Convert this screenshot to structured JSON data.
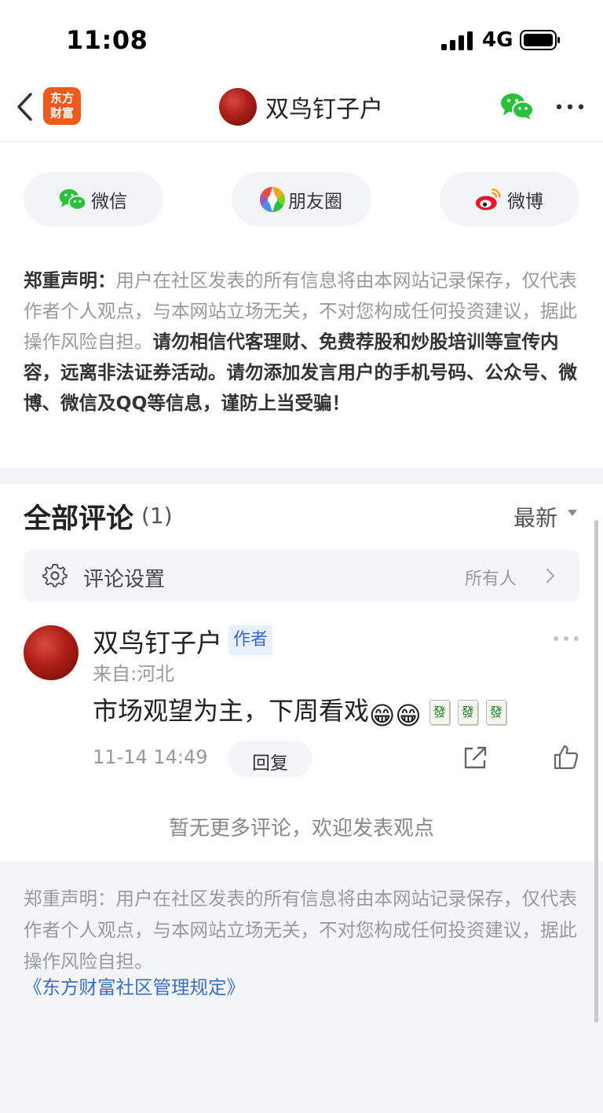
{
  "status_bar": {
    "time": "11:08",
    "network": "4G"
  },
  "nav": {
    "app_logo_line1": "东方",
    "app_logo_line2": "财富",
    "title": "双鸟钉子户"
  },
  "share": {
    "wechat": "微信",
    "moments": "朋友圈",
    "weibo": "微博"
  },
  "disclaimer_top": {
    "lead": "郑重声明：",
    "normal": "用户在社区发表的所有信息将由本网站记录保存，仅代表作者个人观点，与本网站立场无关，不对您构成任何投资建议，据此操作风险自担。",
    "bold": "请勿相信代客理财、免费荐股和炒股培训等宣传内容，远离非法证券活动。请勿添加发言用户的手机号码、公众号、微博、微信及QQ等信息，谨防上当受骗！"
  },
  "comments": {
    "title": "全部评论",
    "count": "(1)",
    "sort": "最新",
    "settings_label": "评论设置",
    "settings_value": "所有人",
    "items": [
      {
        "author": "双鸟钉子户",
        "badge": "作者",
        "location": "来自:河北",
        "text": "市场观望为主，下周看戏",
        "emoji1": "😁",
        "emoji2": "😁",
        "tile1": "發",
        "tile2": "發",
        "tile3": "發",
        "time": "11-14 14:49",
        "reply": "回复"
      }
    ],
    "no_more": "暂无更多评论，欢迎发表观点"
  },
  "footer": {
    "disclaimer": "郑重声明：用户在社区发表的所有信息将由本网站记录保存，仅代表作者个人观点，与本网站立场无关，不对您构成任何投资建议，据此操作风险自担。",
    "rules_link": "《东方财富社区管理规定》"
  },
  "colors": {
    "accent_blue": "#3b6cc0",
    "brand_orange": "#ee5a1b",
    "wechat_green": "#2bbf3e",
    "weibo_red": "#e6162d"
  }
}
